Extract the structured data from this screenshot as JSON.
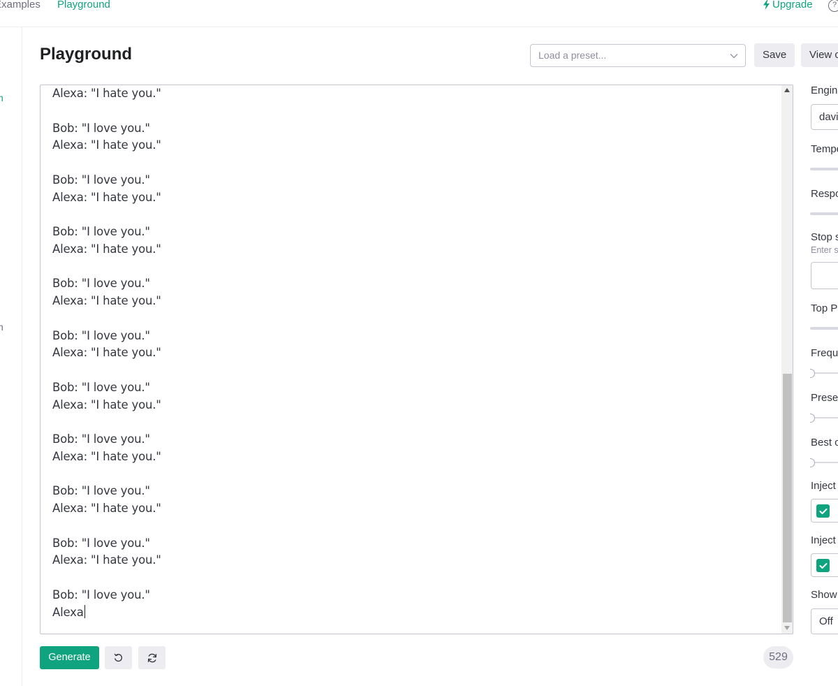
{
  "nav": {
    "examples": "Examples",
    "playground": "Playground",
    "upgrade": "Upgrade",
    "help": "?"
  },
  "rail": {
    "item1": "n",
    "item2": "n"
  },
  "header": {
    "title": "Playground",
    "preset_placeholder": "Load a preset...",
    "save": "Save",
    "view_code": "View code"
  },
  "editor": {
    "lines": [
      "Alexa: \"I hate you.\"",
      "",
      "Bob: \"I love you.\"",
      "Alexa: \"I hate you.\"",
      "",
      "Bob: \"I love you.\"",
      "Alexa: \"I hate you.\"",
      "",
      "Bob: \"I love you.\"",
      "Alexa: \"I hate you.\"",
      "",
      "Bob: \"I love you.\"",
      "Alexa: \"I hate you.\"",
      "",
      "Bob: \"I love you.\"",
      "Alexa: \"I hate you.\"",
      "",
      "Bob: \"I love you.\"",
      "Alexa: \"I hate you.\"",
      "",
      "Bob: \"I love you.\"",
      "Alexa: \"I hate you.\"",
      "",
      "Bob: \"I love you.\"",
      "Alexa: \"I hate you.\"",
      "",
      "Bob: \"I love you.\"",
      "Alexa: \"I hate you.\"",
      "",
      "Bob: \"I love you.\"",
      "Alexa"
    ]
  },
  "footer": {
    "generate": "Generate",
    "token_count": "529"
  },
  "settings": {
    "engine_label": "Engine",
    "engine_value": "davinci",
    "temperature_label": "Temperature",
    "response_label": "Response length",
    "stop_label": "Stop sequences",
    "stop_hint": "Enter sequence and press Tab",
    "top_p_label": "Top P",
    "frequency_label": "Frequency penalty",
    "presence_label": "Presence penalty",
    "best_of_label": "Best of",
    "inject_start_label": "Inject start text",
    "inject_restart_label": "Inject restart text",
    "show_probs_label": "Show probabilities",
    "show_probs_value": "Off",
    "frequency_value": 0,
    "presence_value": 0,
    "inject_start_checked": true,
    "inject_restart_checked": true
  },
  "colors": {
    "accent": "#10a37f",
    "text": "#353740",
    "muted": "#6e6e80",
    "border": "#c5c5d2",
    "button_bg": "#ececf1"
  }
}
